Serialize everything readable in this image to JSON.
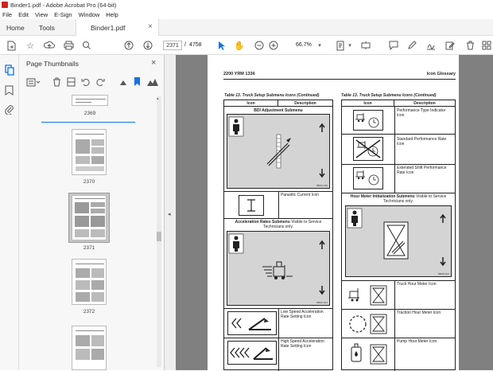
{
  "window": {
    "title": "Binder1.pdf - Adobe Acrobat Pro (64-bit)"
  },
  "menu": [
    "File",
    "Edit",
    "View",
    "E-Sign",
    "Window",
    "Help"
  ],
  "tabs": {
    "home": "Home",
    "tools": "Tools",
    "document": "Binder1.pdf"
  },
  "toolbar": {
    "current_page": "2371",
    "page_separator": "/",
    "total_pages": "4758",
    "zoom": "66.7%"
  },
  "thumbnails": {
    "title": "Page Thumbnails",
    "pages": [
      "2369",
      "2370",
      "2371",
      "2372"
    ],
    "selected": "2371"
  },
  "document": {
    "header_left": "2200 YRM 1336",
    "header_right": "Icon Glossary",
    "left_table": {
      "caption": "Table 13. Truck Setup Submenu Icons (Continued)",
      "col_icon": "Icon",
      "col_desc": "Description",
      "bdi_title": "BDI Adjustment Submenu",
      "bdi_code": "BB000-1000",
      "parasitic": "Parasitic Current Icon",
      "accel_title_bold": "Acceleration Rates Submenu",
      "accel_title_rest": " Visible to Service Technicians only.",
      "accel_code": "BB000-1101",
      "low_speed": "Low Speed Acceleration Rate Setting Icon",
      "high_speed": "High Speed Acceleration Rate Setting Icon"
    },
    "right_table": {
      "caption": "Table 13. Truck Setup Submenu Icons (Continued)",
      "col_icon": "Icon",
      "col_desc": "Description",
      "perf_type": "Performance Type Indicator Icon",
      "std_perf": "Standard Performance Rate Icon",
      "ext_shift": "Extended Shift Performance Rate Icon",
      "hour_title_bold": "Hour Meter Initialization Submenu",
      "hour_title_rest": " Visible to Service Technicians only.",
      "hour_code": "BB000-0013",
      "truck_hour": "Truck Hour Meter Icon",
      "traction_hour": "Traction Hour Meter Icon",
      "pump_hour": "Pump Hour Meter Icon"
    }
  },
  "colors": {
    "accent_blue": "#1473e6",
    "pdf_red": "#d0241c",
    "canvas_gray": "#808080"
  }
}
